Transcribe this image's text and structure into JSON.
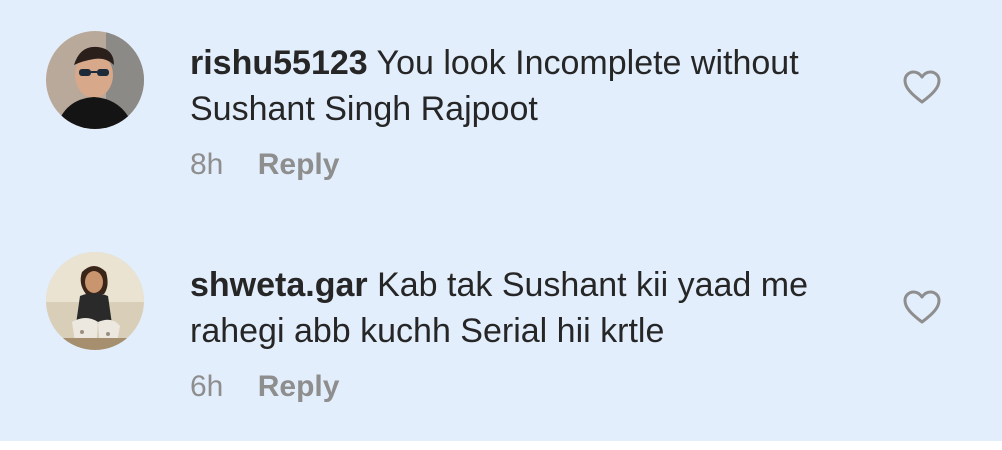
{
  "comments": [
    {
      "username": "rishu55123",
      "text": "You look Incomplete without Sushant Singh Rajpoot",
      "time": "8h",
      "reply_label": "Reply",
      "avatar_icon": "user-avatar-photo",
      "like_icon": "heart-outline-icon"
    },
    {
      "username": "shweta.gar",
      "text": "Kab tak Sushant kii yaad me rahegi abb kuchh Serial hii krtle",
      "time": "6h",
      "reply_label": "Reply",
      "avatar_icon": "user-avatar-photo",
      "like_icon": "heart-outline-icon"
    }
  ],
  "colors": {
    "background": "#e3eefc",
    "text": "#262626",
    "muted": "#8e8e8e"
  }
}
